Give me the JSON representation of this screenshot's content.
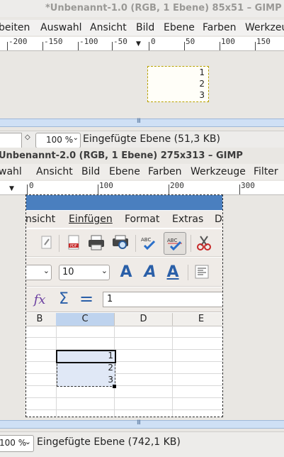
{
  "window1": {
    "title": "*Unbenannt-1.0 (RGB, 1 Ebene) 85x51 – GIMP",
    "menu": [
      "beiten",
      "Auswahl",
      "Ansicht",
      "Bild",
      "Ebene",
      "Farben",
      "Werkzeu"
    ],
    "ruler": [
      "-200",
      "-150",
      "-100",
      "-50",
      "0",
      "50",
      "100",
      "150"
    ],
    "canvas_numbers": [
      "1",
      "2",
      "3"
    ],
    "zoom": "100 %",
    "status": "Eingefügte Ebene (51,3 KB)"
  },
  "window2": {
    "title": "Unbenannt-2.0 (RGB, 1 Ebene) 275x313 – GIMP",
    "menu": [
      "wahl",
      "Ansicht",
      "Bild",
      "Ebene",
      "Farben",
      "Werkzeuge",
      "Filter"
    ],
    "ruler": [
      "0",
      "100",
      "200",
      "300"
    ],
    "zoom": "100 %",
    "status": "Eingefügte Ebene (742,1 KB)"
  },
  "calc": {
    "menu": [
      "nsicht",
      "Einfügen",
      "Format",
      "Extras",
      "D"
    ],
    "font_size": "10",
    "formula_value": "1",
    "col_headers": [
      "B",
      "C",
      "D",
      "E"
    ],
    "cells": [
      "1",
      "2",
      "3"
    ]
  },
  "colors": {
    "selection_blue": "#4a7fbf",
    "divider_blue": "#cfe0f5"
  }
}
